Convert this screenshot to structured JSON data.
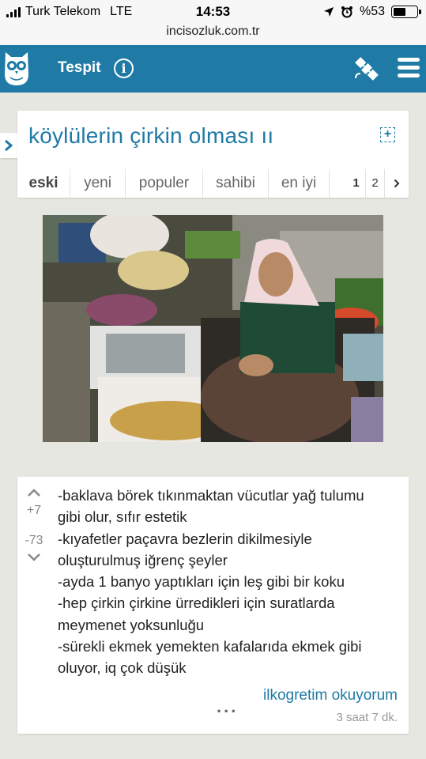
{
  "status_bar": {
    "carrier": "Turk Telekom",
    "network": "LTE",
    "time": "14:53",
    "battery": "%53",
    "battery_level": 0.53
  },
  "browser": {
    "url": "incisozluk.com.tr"
  },
  "header": {
    "section": "Tespit",
    "info_icon": "info-icon",
    "satellite_icon": "satellite-icon",
    "menu_icon": "hamburger-menu-icon"
  },
  "topic": {
    "title": "köylülerin çirkin olması ıı",
    "tabs": [
      "eski",
      "yeni",
      "populer",
      "sahibi",
      "en iyi"
    ],
    "active_tab": "eski",
    "pages": [
      "1",
      "2"
    ],
    "current_page": "1",
    "next_icon": "chevron-right-icon"
  },
  "entry": {
    "up_votes": "+7",
    "down_votes": "-73",
    "lines": [
      "-baklava börek tıkınmaktan vücutlar yağ tulumu",
      "gibi olur, sıfır estetik",
      "-kıyafetler paçavra bezlerin dikilmesiyle",
      "oluşturulmuş iğrenç şeyler",
      "-ayda 1 banyo yaptıkları için leş gibi bir koku",
      "-hep çirkin çirkine ürredikleri için suratlarda",
      "meymenet yoksunluğu",
      "-sürekli ekmek yemekten kafalarıda ekmek gibi",
      "oluyor, iq çok düşük"
    ],
    "more": "...",
    "author": "ilkogretim okuyorum",
    "time": "3 saat 7 dk."
  },
  "colors": {
    "brand": "#1f7aa5",
    "background": "#e7e7e2"
  }
}
